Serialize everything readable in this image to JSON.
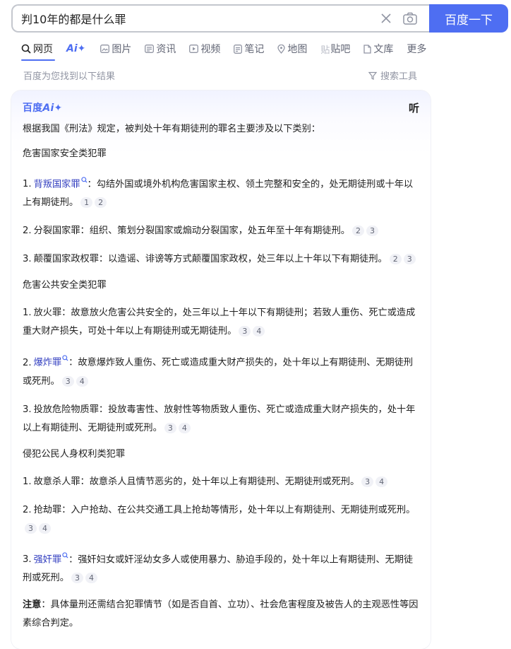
{
  "search": {
    "query": "判10年的都是什么罪",
    "button_label": "百度一下"
  },
  "tabs": [
    {
      "label": "网页",
      "icon": "search-icon"
    },
    {
      "label": "AI+",
      "icon": "ai-icon"
    },
    {
      "label": "图片",
      "icon": "image-icon"
    },
    {
      "label": "资讯",
      "icon": "news-icon"
    },
    {
      "label": "视频",
      "icon": "video-icon"
    },
    {
      "label": "笔记",
      "icon": "note-icon"
    },
    {
      "label": "地图",
      "icon": "map-pin-icon"
    },
    {
      "label": "贴吧",
      "icon": "tieba-icon"
    },
    {
      "label": "文库",
      "icon": "doc-icon"
    },
    {
      "label": "更多",
      "icon": ""
    }
  ],
  "result_count": "百度为您找到以下结果",
  "search_tools": "搜索工具",
  "ai_card": {
    "brand_text": "百度",
    "brand_ai": "Ai",
    "listen_label": "听",
    "intro": "根据我国《刑法》规定，被判处十年有期徒刑的罪名主要涉及以下类别：",
    "sections": [
      {
        "heading": "危害国家安全类犯罪",
        "items": [
          {
            "num": "1.",
            "keyword": "背叛国家罪",
            "link": true,
            "text": "：勾结外国或境外机构危害国家主权、领土完整和安全的，处无期徒刑或十年以上有期徒刑。",
            "cites": [
              "1",
              "2"
            ]
          },
          {
            "num": "2.",
            "keyword": "分裂国家罪",
            "link": false,
            "text": "：组织、策划分裂国家或煽动分裂国家，处五年至十年有期徒刑。",
            "cites": [
              "2",
              "3"
            ]
          },
          {
            "num": "3.",
            "keyword": "颠覆国家政权罪",
            "link": false,
            "text": "：以造谣、诽谤等方式颠覆国家政权，处三年以上十年以下有期徒刑。",
            "cites": [
              "2",
              "3"
            ]
          }
        ]
      },
      {
        "heading": "危害公共安全类犯罪",
        "items": [
          {
            "num": "1.",
            "keyword": "放火罪",
            "link": false,
            "text": "：故意放火危害公共安全的，处三年以上十年以下有期徒刑；若致人重伤、死亡或造成重大财产损失，可处十年以上有期徒刑或无期徒刑。",
            "cites": [
              "3",
              "4"
            ]
          },
          {
            "num": "2.",
            "keyword": "爆炸罪",
            "link": true,
            "text": "：故意爆炸致人重伤、死亡或造成重大财产损失的，处十年以上有期徒刑、无期徒刑或死刑。",
            "cites": [
              "3",
              "4"
            ]
          },
          {
            "num": "3.",
            "keyword": "投放危险物质罪",
            "link": false,
            "text": "：投放毒害性、放射性等物质致人重伤、死亡或造成重大财产损失的，处十年以上有期徒刑、无期徒刑或死刑。",
            "cites": [
              "3",
              "4"
            ]
          }
        ]
      },
      {
        "heading": "侵犯公民人身权利类犯罪",
        "items": [
          {
            "num": "1.",
            "keyword": "故意杀人罪",
            "link": false,
            "text": "：故意杀人且情节恶劣的，处十年以上有期徒刑、无期徒刑或死刑。",
            "cites": [
              "3",
              "4"
            ]
          },
          {
            "num": "2.",
            "keyword": "抢劫罪",
            "link": false,
            "text": "：入户抢劫、在公共交通工具上抢劫等情形，处十年以上有期徒刑、无期徒刑或死刑。",
            "cites": [
              "3",
              "4"
            ]
          },
          {
            "num": "3.",
            "keyword": "强奸罪",
            "link": true,
            "text": "：强奸妇女或奸淫幼女多人或使用暴力、胁迫手段的，处十年以上有期徒刑、无期徒刑或死刑。",
            "cites": [
              "3",
              "4"
            ]
          }
        ]
      }
    ],
    "note_label": "注意",
    "note_text": "：具体量刑还需结合犯罪情节（如是否自首、立功）、社会危害程度及被告人的主观恶性等因素综合判定。"
  },
  "colors": {
    "accent": "#4e6ef2",
    "link": "#3440c0",
    "muted": "#9195a3"
  }
}
